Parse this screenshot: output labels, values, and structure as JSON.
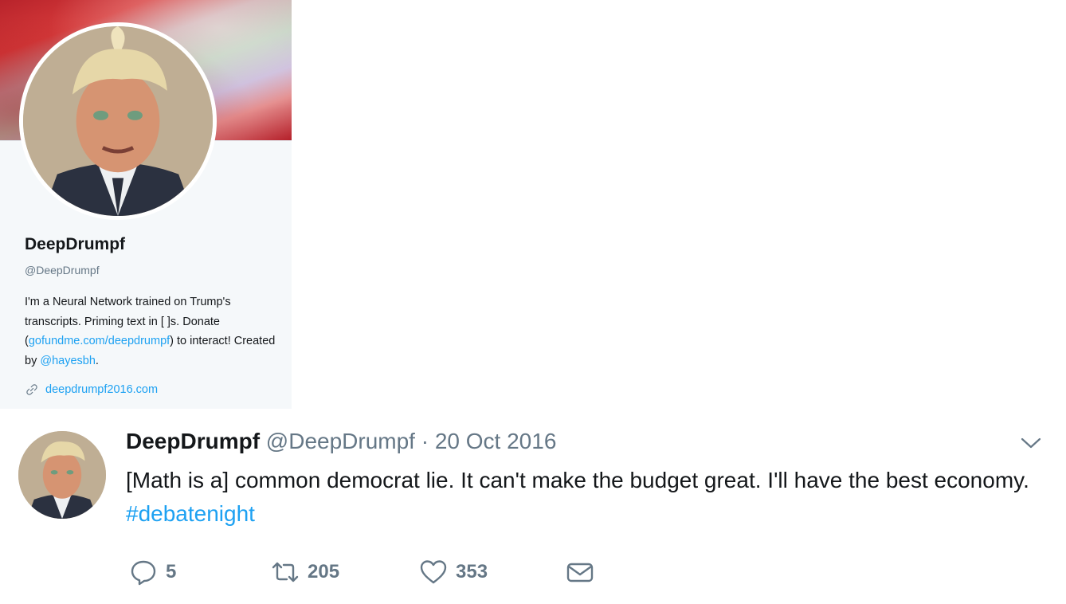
{
  "profile": {
    "name": "DeepDrumpf",
    "handle": "@DeepDrumpf",
    "bio_part1": "I'm a Neural Network trained on Trump's transcripts. Priming text in [ ]s. Donate (",
    "bio_link1": "gofundme.com/deepdrumpf",
    "bio_part2": ") to interact! Created by ",
    "bio_link2": "@hayesbh",
    "bio_part3": ".",
    "website": "deepdrumpf2016.com"
  },
  "tweet": {
    "name": "DeepDrumpf",
    "handle": "@DeepDrumpf",
    "separator": "·",
    "date": "20 Oct 2016",
    "text": "[Math is a] common democrat lie. It can't make the budget great. I'll have the best economy. ",
    "hashtag": "#debatenight",
    "replies": "5",
    "retweets": "205",
    "likes": "353"
  },
  "colors": {
    "link": "#1da1f2",
    "secondary_text": "#657786",
    "card_bg": "#f5f8fa"
  },
  "icons": [
    "link-icon",
    "chevron-down-icon",
    "reply-icon",
    "retweet-icon",
    "heart-icon",
    "envelope-icon"
  ]
}
